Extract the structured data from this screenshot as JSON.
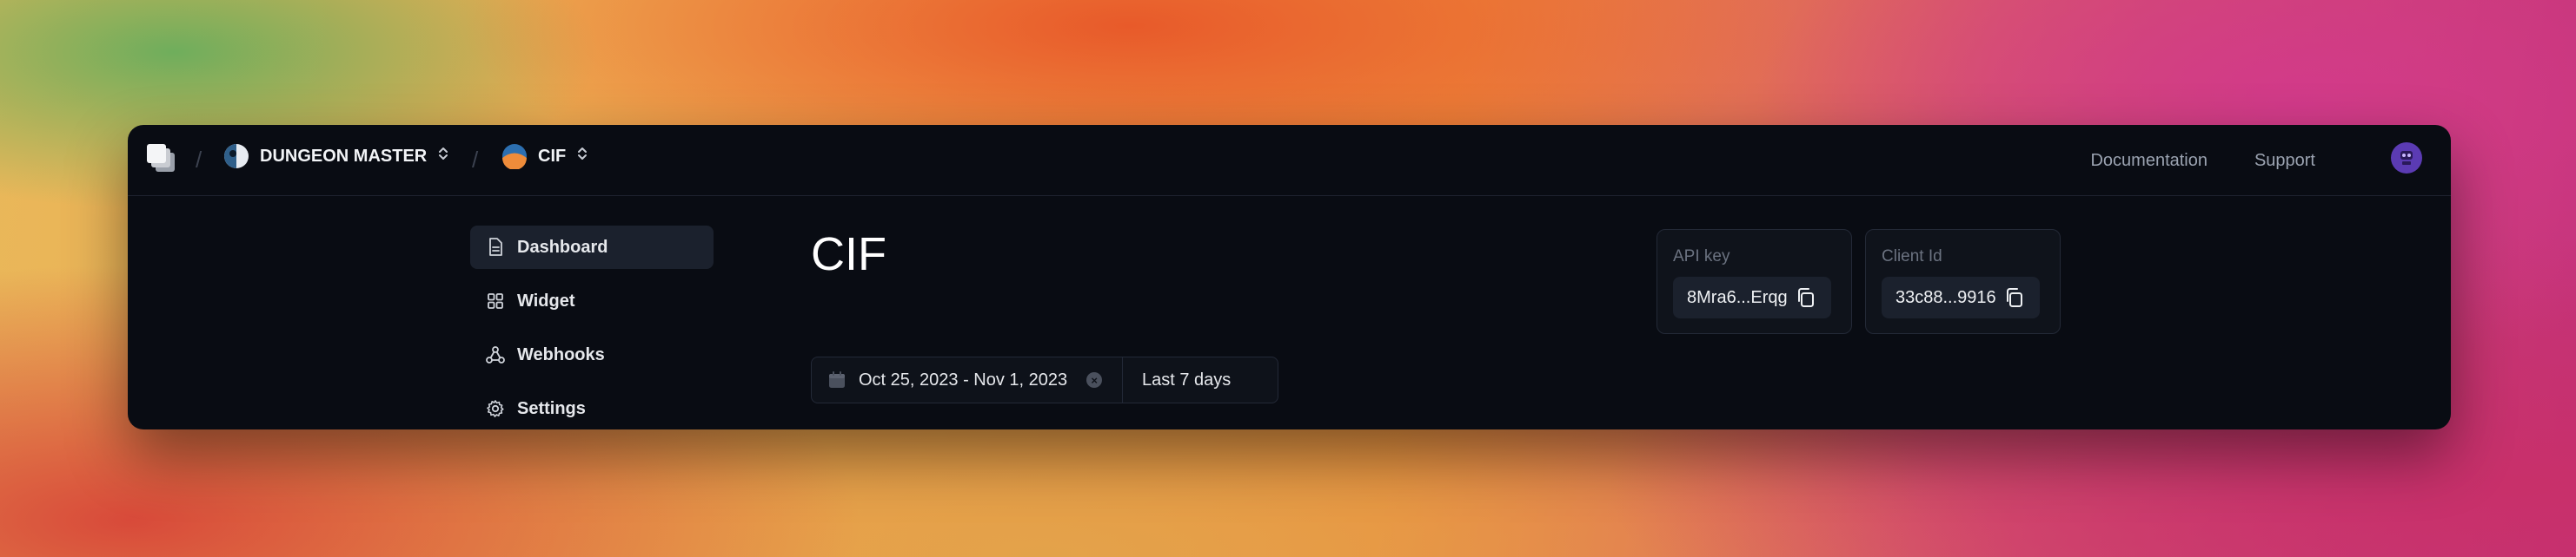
{
  "topbar": {
    "separator": "/",
    "org": {
      "name": "DUNGEON MASTER",
      "icon": "org-avatar-icon"
    },
    "project": {
      "name": "CIF",
      "icon": "project-avatar-icon"
    },
    "links": {
      "documentation": "Documentation",
      "support": "Support"
    },
    "user_avatar_icon": "user-avatar-icon"
  },
  "sidebar": {
    "items": [
      {
        "label": "Dashboard",
        "icon": "document-icon",
        "active": true
      },
      {
        "label": "Widget",
        "icon": "grid-icon",
        "active": false
      },
      {
        "label": "Webhooks",
        "icon": "webhook-icon",
        "active": false
      },
      {
        "label": "Settings",
        "icon": "gear-icon",
        "active": false
      }
    ]
  },
  "main": {
    "title": "CIF",
    "date_range": {
      "value": "Oct 25, 2023 - Nov 1, 2023",
      "preset": "Last 7 days"
    }
  },
  "credentials": {
    "api_key": {
      "label": "API key",
      "value": "8Mra6...Erqg"
    },
    "client_id": {
      "label": "Client Id",
      "value": "33c88...9916"
    }
  },
  "colors": {
    "window_bg": "#090c13",
    "active_item_bg": "#1b212d",
    "text_primary": "#f2f4f7",
    "text_muted": "#9ba3b1",
    "avatar": "#5b3bb3"
  }
}
